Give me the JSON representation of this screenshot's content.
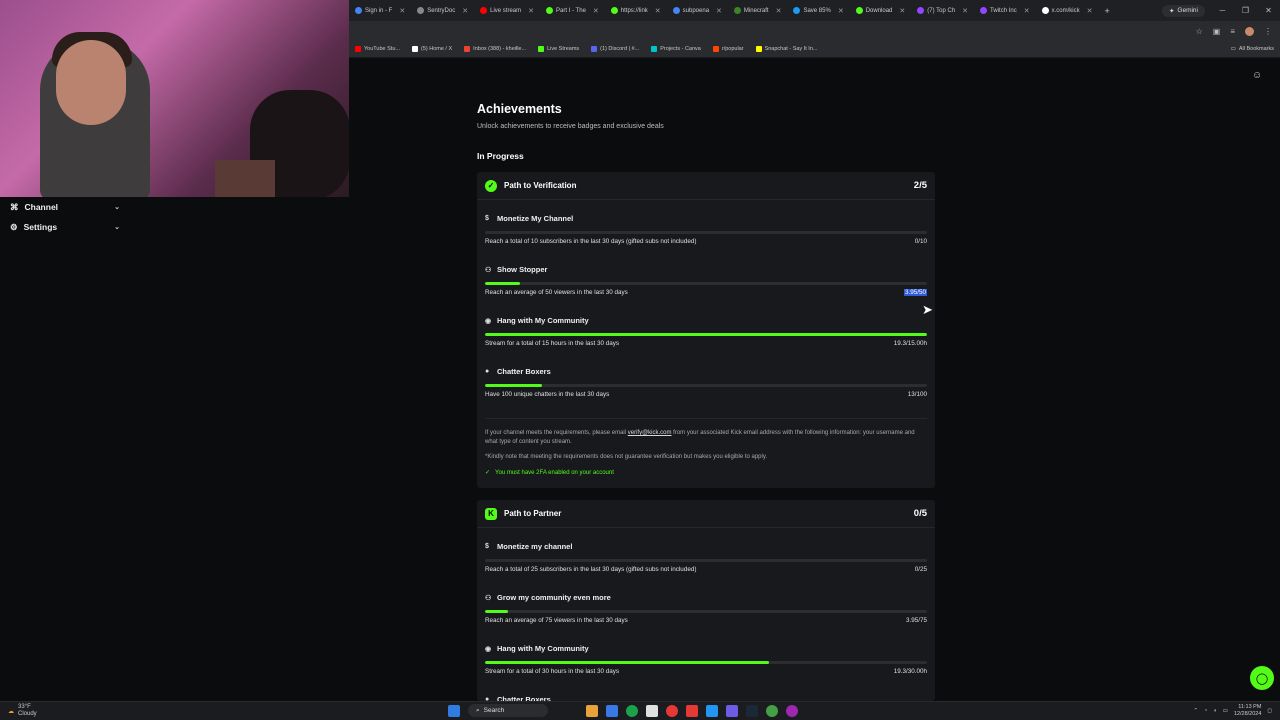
{
  "browser": {
    "tabs": [
      {
        "label": "Sign in - F",
        "color": "#4285f4"
      },
      {
        "label": "SentryDoc",
        "color": "#888888"
      },
      {
        "label": "Live stream",
        "color": "#ff0000"
      },
      {
        "label": "Part I - The",
        "color": "#53fc18"
      },
      {
        "label": "https://link",
        "color": "#53fc18"
      },
      {
        "label": "subpoena",
        "color": "#4285f4"
      },
      {
        "label": "Minecraft",
        "color": "#3c8527"
      },
      {
        "label": "Save 85%",
        "color": "#1b9cf2"
      },
      {
        "label": "Download",
        "color": "#53fc18"
      },
      {
        "label": "(7) Top Ch",
        "color": "#9146ff"
      },
      {
        "label": "Twitch Inc",
        "color": "#9146ff"
      },
      {
        "label": "x.com/kick",
        "color": "#ffffff"
      }
    ],
    "gemini_label": "Gemini",
    "bookmarks": [
      {
        "label": "YouTube Stu...",
        "color": "#ff0000"
      },
      {
        "label": "(5) Home / X",
        "color": "#ffffff"
      },
      {
        "label": "Inbox (388) - kheille...",
        "color": "#ea4335"
      },
      {
        "label": "Live Streams",
        "color": "#53fc18"
      },
      {
        "label": "(1) Discord | #...",
        "color": "#5865f2"
      },
      {
        "label": "Projects - Canva",
        "color": "#00c4cc"
      },
      {
        "label": "r/popular",
        "color": "#ff4500"
      },
      {
        "label": "Snapchat - Say It In...",
        "color": "#fffc00"
      }
    ],
    "all_bookmarks": "All Bookmarks"
  },
  "sidebar": {
    "items": [
      {
        "label": "Channel"
      },
      {
        "label": "Settings"
      }
    ]
  },
  "page": {
    "title": "Achievements",
    "subtitle": "Unlock achievements to receive badges and exclusive deals",
    "section": "In Progress"
  },
  "verification": {
    "title": "Path to Verification",
    "count": "2/5",
    "requirements": [
      {
        "title": "Monetize My Channel",
        "icon": "dollar-icon",
        "desc": "Reach a total of 10 subscribers in the last 30 days (gifted subs not included)",
        "value": "0/10",
        "progress": 0.0
      },
      {
        "title": "Show Stopper",
        "icon": "people-icon",
        "desc": "Reach an average of 50 viewers in the last 30 days",
        "value": "3.95/50",
        "progress": 0.079
      },
      {
        "title": "Hang with My Community",
        "icon": "broadcast-icon",
        "desc": "Stream for a total of 15 hours in the last 30 days",
        "value": "19.3/15.00h",
        "progress": 1.0
      },
      {
        "title": "Chatter Boxers",
        "icon": "chat-icon",
        "desc": "Have 100 unique chatters in the last 30 days",
        "value": "13/100",
        "progress": 0.13
      }
    ],
    "note_prefix": "If your channel meets the requirements, please email ",
    "note_email": "verify@kick.com",
    "note_suffix": " from your associated Kick email address with the following information: your username and what type of content you stream.",
    "note_disclaimer": "*Kindly note that meeting the requirements does not guarantee verification but makes you eligible to apply.",
    "twofa": "You must have 2FA enabled on your account"
  },
  "partner": {
    "title": "Path to Partner",
    "count": "0/5",
    "requirements": [
      {
        "title": "Monetize my channel",
        "icon": "dollar-icon",
        "desc": "Reach a total of 25 subscribers in the last 30 days (gifted subs not included)",
        "value": "0/25",
        "progress": 0.0
      },
      {
        "title": "Grow my community even more",
        "icon": "people-icon",
        "desc": "Reach an average of 75 viewers in the last 30 days",
        "value": "3.95/75",
        "progress": 0.053
      },
      {
        "title": "Hang with My Community",
        "icon": "broadcast-icon",
        "desc": "Stream for a total of 30 hours in the last 30 days",
        "value": "19.3/30.00h",
        "progress": 0.643
      },
      {
        "title": "Chatter Boxers",
        "icon": "chat-icon",
        "desc": "",
        "value": "",
        "progress": 0.0
      }
    ]
  },
  "taskbar": {
    "weather_temp": "33°F",
    "weather_desc": "Cloudy",
    "search": "Search",
    "time": "11:13 PM",
    "date": "12/28/2024"
  },
  "colors": {
    "accent": "#53fc18",
    "background": "#0b0c0e",
    "card": "#18191c",
    "selection": "#2f5bd6"
  }
}
